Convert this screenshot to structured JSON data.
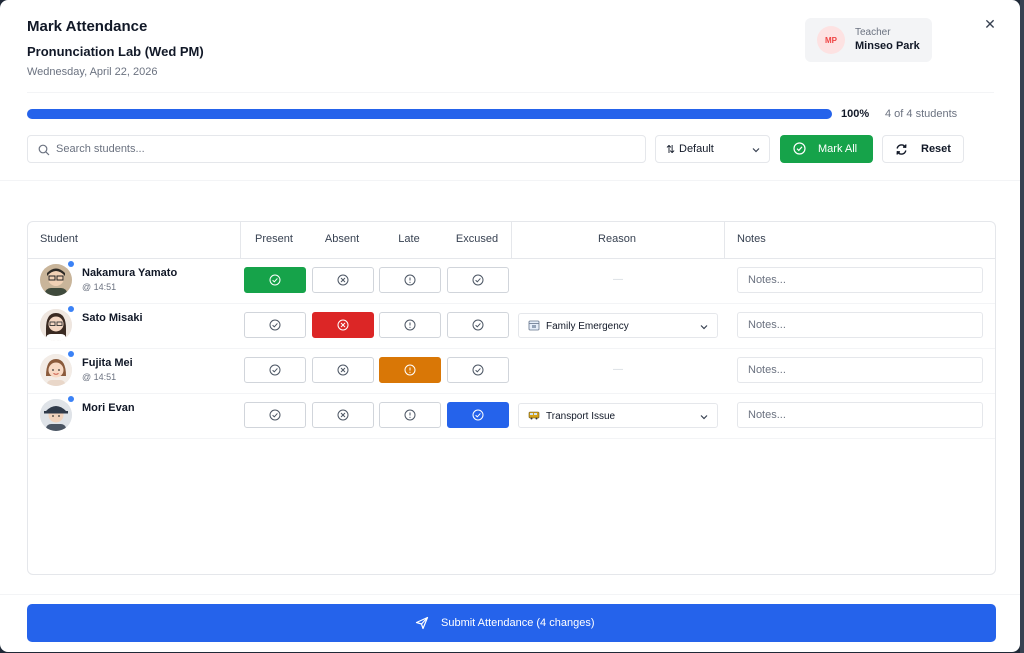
{
  "modal": {
    "title": "Mark Attendance",
    "class_name": "Pronunciation Lab (Wed PM)",
    "date": "Wednesday, April 22, 2026",
    "close_icon": "close-icon"
  },
  "teacher": {
    "initials": "MP",
    "label": "Teacher",
    "name": "Minseo Park"
  },
  "progress": {
    "percent_label": "100%",
    "count_label": "4 of 4 students",
    "fraction": 1.0
  },
  "search": {
    "placeholder": "Search students..."
  },
  "sort": {
    "icon": "sort-icon",
    "selected": "Default"
  },
  "actions": {
    "mark_all": "Mark All",
    "reset": "Reset"
  },
  "table": {
    "headers": {
      "student": "Student",
      "present": "Present",
      "absent": "Absent",
      "late": "Late",
      "excused": "Excused",
      "reason": "Reason",
      "notes": "Notes"
    },
    "notes_placeholder": "Notes...",
    "empty_reason": "—",
    "rows": [
      {
        "name": "Nakamura Yamato",
        "time": "@ 14:51",
        "status": "present",
        "reason": "",
        "reason_icon": ""
      },
      {
        "name": "Sato Misaki",
        "time": "",
        "status": "absent",
        "reason": "Family Emergency",
        "reason_icon": "calendar-icon"
      },
      {
        "name": "Fujita Mei",
        "time": "@ 14:51",
        "status": "late",
        "reason": "",
        "reason_icon": ""
      },
      {
        "name": "Mori Evan",
        "time": "",
        "status": "excused",
        "reason": "Transport Issue",
        "reason_icon": "bus-icon"
      }
    ]
  },
  "submit": {
    "label": "Submit Attendance (4 changes)",
    "icon": "send-icon"
  },
  "colors": {
    "primary": "#2563eb",
    "present": "#16a34a",
    "absent": "#dc2626",
    "late": "#d97706",
    "excused": "#2563eb"
  }
}
